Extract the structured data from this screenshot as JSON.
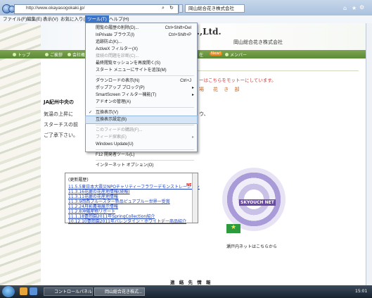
{
  "browser": {
    "url": "http://www.okayasogokaki.jp/",
    "tab_title": "岡山総合花き株式会社"
  },
  "menubar": [
    "ファイル(F)",
    "編集(E)",
    "表示(V)",
    "お気に入り(A)",
    "ツール(T)",
    "ヘルプ(H)"
  ],
  "page": {
    "logo": "o.,Ltd.",
    "company": "岡山総合花き株式会社",
    "nav": [
      "トップ",
      "ご挨拶",
      "会社概要",
      "在",
      "メンバー"
    ],
    "new_badge": "New!",
    "notice": "ーはこちらをモットーにしています。",
    "greeting": "場　花 き 部",
    "ja": "JA紀州中央の",
    "lines": [
      "気温の上昇に",
      "スターチスの前",
      "ご了承下さい。"
    ],
    "line_tail": "ウ、",
    "news_header": "(更新履歴)",
    "news": [
      "11.5.5東日本大震災NPOチャリティーフラワーデモンストレーション",
      "11.3.16花麗の花産地情報(続報)",
      "11.3.11花麗の花産地情報",
      "11.3.9岡西プルースター新品ピュアブルー世界一受賞",
      "11.2.24月影農場展示情報",
      "11.2.8沖縄産物リポート",
      "11.1.18豊岡園2011年SpringCollection紹介",
      "10.12.10豊岡園2011年バレンタイン・ホワイトデー商品紹介"
    ],
    "news_red_tag": "NEW",
    "badge_text": "SKYOUCH NET",
    "badge_caption": "瀬戸内ネットはこちらから",
    "contact": "連 絡 先 情 報"
  },
  "dropdown": [
    {
      "label": "閲覧の履歴の削除(D)...",
      "shortcut": "Ctrl+Shift+Del"
    },
    {
      "label": "InPrivate ブラウズ(I)",
      "shortcut": "Ctrl+Shift+P"
    },
    {
      "label": "追跡防止(K)..."
    },
    {
      "label": "ActiveX フィルター(X)"
    },
    {
      "label": "接続の問題を診断(C)...",
      "disabled": true
    },
    {
      "label": "最終閲覧セッションを再度開く(S)"
    },
    {
      "label": "スタート メニューにサイトを追加(M)"
    },
    {
      "sep": true
    },
    {
      "label": "ダウンロードの表示(N)",
      "shortcut": "Ctrl+J"
    },
    {
      "label": "ポップアップ ブロック(P)",
      "arrow": true
    },
    {
      "label": "SmartScreen フィルター機能(T)",
      "arrow": true
    },
    {
      "label": "アドオンの管理(A)"
    },
    {
      "sep": true
    },
    {
      "label": "互換表示(V)",
      "checked": true
    },
    {
      "label": "互換表示設定(B)",
      "highlight": true
    },
    {
      "sep": true
    },
    {
      "label": "このフィードの購読(F)...",
      "disabled": true
    },
    {
      "label": "フィード探索(E)",
      "disabled": true,
      "arrow": true
    },
    {
      "label": "Windows Update(U)"
    },
    {
      "sep": true
    },
    {
      "label": "F12 開発者ツール(L)"
    },
    {
      "sep": true
    },
    {
      "label": "インターネット オプション(O)"
    }
  ],
  "taskbar": {
    "tasks": [
      "コントロールパネル",
      "岡山総合花き株式..."
    ],
    "clock": "15:01"
  }
}
